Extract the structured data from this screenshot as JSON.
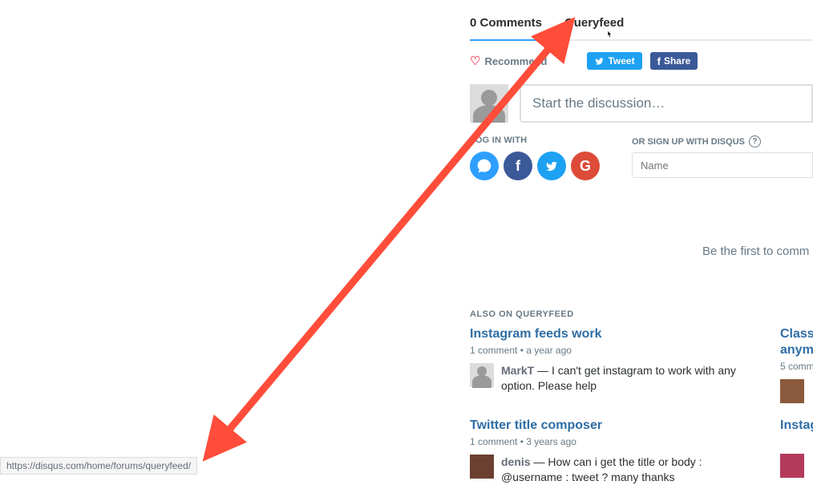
{
  "header": {
    "tab_comments": "0 Comments",
    "tab_site": "Queryfeed"
  },
  "actions": {
    "recommend": "Recommend",
    "tweet": "Tweet",
    "share": "Share"
  },
  "compose": {
    "placeholder": "Start the discussion…"
  },
  "login": {
    "label": "LOG IN WITH"
  },
  "signup": {
    "label": "OR SIGN UP WITH DISQUS",
    "name_placeholder": "Name"
  },
  "first_comment": "Be the first to comm",
  "also_on": "ALSO ON QUERYFEED",
  "cards": [
    {
      "title": "Instagram feeds work",
      "meta": "1 comment • a year ago",
      "author": "MarkT",
      "text": " — I can't get instagram to work with any option. Please help"
    },
    {
      "title": "Class",
      "title2": "anym",
      "meta": "5 comm"
    },
    {
      "title": "Twitter title composer",
      "meta": "1 comment • 3 years ago",
      "author": "denis",
      "text": " — How can i get the title or body : @username : tweet ? many thanks"
    },
    {
      "title": "Instag"
    }
  ],
  "status_url": "https://disqus.com/home/forums/queryfeed/"
}
